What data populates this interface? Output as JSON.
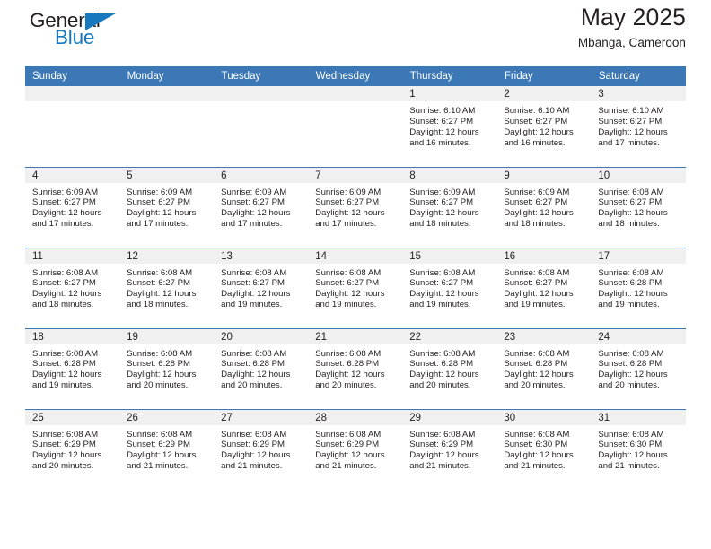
{
  "brand": {
    "name_dark": "General",
    "name_blue": "Blue",
    "accent_color": "#1878be",
    "header_color": "#3b78b5"
  },
  "header": {
    "title": "May 2025",
    "subtitle": "Mbanga, Cameroon"
  },
  "calendar": {
    "weekday_headers": [
      "Sunday",
      "Monday",
      "Tuesday",
      "Wednesday",
      "Thursday",
      "Friday",
      "Saturday"
    ],
    "labels": {
      "sunrise": "Sunrise:",
      "sunset": "Sunset:",
      "daylight": "Daylight:"
    },
    "weeks": [
      [
        {
          "day": "",
          "empty": true
        },
        {
          "day": "",
          "empty": true
        },
        {
          "day": "",
          "empty": true
        },
        {
          "day": "",
          "empty": true
        },
        {
          "day": "1",
          "sunrise": "Sunrise: 6:10 AM",
          "sunset": "Sunset: 6:27 PM",
          "daylight": "Daylight: 12 hours and 16 minutes."
        },
        {
          "day": "2",
          "sunrise": "Sunrise: 6:10 AM",
          "sunset": "Sunset: 6:27 PM",
          "daylight": "Daylight: 12 hours and 16 minutes."
        },
        {
          "day": "3",
          "sunrise": "Sunrise: 6:10 AM",
          "sunset": "Sunset: 6:27 PM",
          "daylight": "Daylight: 12 hours and 17 minutes."
        }
      ],
      [
        {
          "day": "4",
          "sunrise": "Sunrise: 6:09 AM",
          "sunset": "Sunset: 6:27 PM",
          "daylight": "Daylight: 12 hours and 17 minutes."
        },
        {
          "day": "5",
          "sunrise": "Sunrise: 6:09 AM",
          "sunset": "Sunset: 6:27 PM",
          "daylight": "Daylight: 12 hours and 17 minutes."
        },
        {
          "day": "6",
          "sunrise": "Sunrise: 6:09 AM",
          "sunset": "Sunset: 6:27 PM",
          "daylight": "Daylight: 12 hours and 17 minutes."
        },
        {
          "day": "7",
          "sunrise": "Sunrise: 6:09 AM",
          "sunset": "Sunset: 6:27 PM",
          "daylight": "Daylight: 12 hours and 17 minutes."
        },
        {
          "day": "8",
          "sunrise": "Sunrise: 6:09 AM",
          "sunset": "Sunset: 6:27 PM",
          "daylight": "Daylight: 12 hours and 18 minutes."
        },
        {
          "day": "9",
          "sunrise": "Sunrise: 6:09 AM",
          "sunset": "Sunset: 6:27 PM",
          "daylight": "Daylight: 12 hours and 18 minutes."
        },
        {
          "day": "10",
          "sunrise": "Sunrise: 6:08 AM",
          "sunset": "Sunset: 6:27 PM",
          "daylight": "Daylight: 12 hours and 18 minutes."
        }
      ],
      [
        {
          "day": "11",
          "sunrise": "Sunrise: 6:08 AM",
          "sunset": "Sunset: 6:27 PM",
          "daylight": "Daylight: 12 hours and 18 minutes."
        },
        {
          "day": "12",
          "sunrise": "Sunrise: 6:08 AM",
          "sunset": "Sunset: 6:27 PM",
          "daylight": "Daylight: 12 hours and 18 minutes."
        },
        {
          "day": "13",
          "sunrise": "Sunrise: 6:08 AM",
          "sunset": "Sunset: 6:27 PM",
          "daylight": "Daylight: 12 hours and 19 minutes."
        },
        {
          "day": "14",
          "sunrise": "Sunrise: 6:08 AM",
          "sunset": "Sunset: 6:27 PM",
          "daylight": "Daylight: 12 hours and 19 minutes."
        },
        {
          "day": "15",
          "sunrise": "Sunrise: 6:08 AM",
          "sunset": "Sunset: 6:27 PM",
          "daylight": "Daylight: 12 hours and 19 minutes."
        },
        {
          "day": "16",
          "sunrise": "Sunrise: 6:08 AM",
          "sunset": "Sunset: 6:27 PM",
          "daylight": "Daylight: 12 hours and 19 minutes."
        },
        {
          "day": "17",
          "sunrise": "Sunrise: 6:08 AM",
          "sunset": "Sunset: 6:28 PM",
          "daylight": "Daylight: 12 hours and 19 minutes."
        }
      ],
      [
        {
          "day": "18",
          "sunrise": "Sunrise: 6:08 AM",
          "sunset": "Sunset: 6:28 PM",
          "daylight": "Daylight: 12 hours and 19 minutes."
        },
        {
          "day": "19",
          "sunrise": "Sunrise: 6:08 AM",
          "sunset": "Sunset: 6:28 PM",
          "daylight": "Daylight: 12 hours and 20 minutes."
        },
        {
          "day": "20",
          "sunrise": "Sunrise: 6:08 AM",
          "sunset": "Sunset: 6:28 PM",
          "daylight": "Daylight: 12 hours and 20 minutes."
        },
        {
          "day": "21",
          "sunrise": "Sunrise: 6:08 AM",
          "sunset": "Sunset: 6:28 PM",
          "daylight": "Daylight: 12 hours and 20 minutes."
        },
        {
          "day": "22",
          "sunrise": "Sunrise: 6:08 AM",
          "sunset": "Sunset: 6:28 PM",
          "daylight": "Daylight: 12 hours and 20 minutes."
        },
        {
          "day": "23",
          "sunrise": "Sunrise: 6:08 AM",
          "sunset": "Sunset: 6:28 PM",
          "daylight": "Daylight: 12 hours and 20 minutes."
        },
        {
          "day": "24",
          "sunrise": "Sunrise: 6:08 AM",
          "sunset": "Sunset: 6:28 PM",
          "daylight": "Daylight: 12 hours and 20 minutes."
        }
      ],
      [
        {
          "day": "25",
          "sunrise": "Sunrise: 6:08 AM",
          "sunset": "Sunset: 6:29 PM",
          "daylight": "Daylight: 12 hours and 20 minutes."
        },
        {
          "day": "26",
          "sunrise": "Sunrise: 6:08 AM",
          "sunset": "Sunset: 6:29 PM",
          "daylight": "Daylight: 12 hours and 21 minutes."
        },
        {
          "day": "27",
          "sunrise": "Sunrise: 6:08 AM",
          "sunset": "Sunset: 6:29 PM",
          "daylight": "Daylight: 12 hours and 21 minutes."
        },
        {
          "day": "28",
          "sunrise": "Sunrise: 6:08 AM",
          "sunset": "Sunset: 6:29 PM",
          "daylight": "Daylight: 12 hours and 21 minutes."
        },
        {
          "day": "29",
          "sunrise": "Sunrise: 6:08 AM",
          "sunset": "Sunset: 6:29 PM",
          "daylight": "Daylight: 12 hours and 21 minutes."
        },
        {
          "day": "30",
          "sunrise": "Sunrise: 6:08 AM",
          "sunset": "Sunset: 6:30 PM",
          "daylight": "Daylight: 12 hours and 21 minutes."
        },
        {
          "day": "31",
          "sunrise": "Sunrise: 6:08 AM",
          "sunset": "Sunset: 6:30 PM",
          "daylight": "Daylight: 12 hours and 21 minutes."
        }
      ]
    ]
  }
}
